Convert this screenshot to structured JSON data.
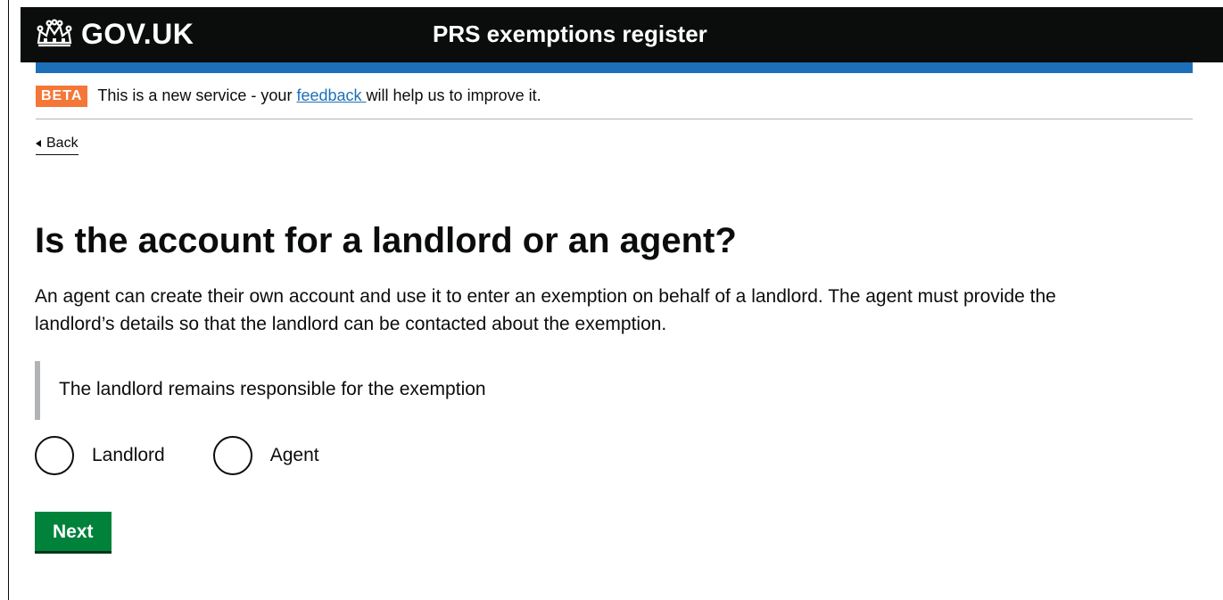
{
  "header": {
    "logo_text": "GOV.UK",
    "logo_icon": "crown-icon",
    "service_name": "PRS exemptions register"
  },
  "phase_banner": {
    "tag": "BETA",
    "text_before": "This is a new service - your ",
    "link_text": "feedback ",
    "text_after": "will help us to improve it."
  },
  "back_link": {
    "label": "Back",
    "icon": "back-arrow-icon"
  },
  "main": {
    "heading": "Is the account for a landlord or an agent?",
    "lead": "An agent can create their own account and use it to enter an exemption on behalf of a landlord. The agent must provide the landlord’s details so that the landlord can be contacted about the exemption.",
    "inset": "The landlord remains responsible for the exemption",
    "radios": [
      {
        "label": "Landlord",
        "selected": false
      },
      {
        "label": "Agent",
        "selected": false
      }
    ],
    "next_button": "Next"
  },
  "colors": {
    "header_bg": "#0b0c0c",
    "blue_bar": "#1d70b8",
    "beta_tag": "#f47738",
    "link": "#1d70b8",
    "button": "#00823b"
  }
}
